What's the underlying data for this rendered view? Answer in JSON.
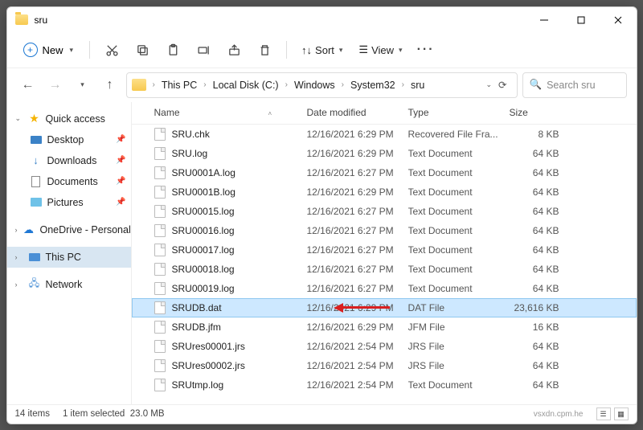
{
  "window": {
    "title": "sru"
  },
  "toolbar": {
    "new_label": "New",
    "sort_label": "Sort",
    "view_label": "View"
  },
  "breadcrumbs": [
    "This PC",
    "Local Disk (C:)",
    "Windows",
    "System32",
    "sru"
  ],
  "search": {
    "placeholder": "Search sru"
  },
  "sidebar": {
    "quick_access": "Quick access",
    "desktop": "Desktop",
    "downloads": "Downloads",
    "documents": "Documents",
    "pictures": "Pictures",
    "onedrive": "OneDrive - Personal",
    "this_pc": "This PC",
    "network": "Network"
  },
  "columns": {
    "name": "Name",
    "date": "Date modified",
    "type": "Type",
    "size": "Size"
  },
  "files": [
    {
      "name": "SRU.chk",
      "date": "12/16/2021 6:29 PM",
      "type": "Recovered File Fra...",
      "size": "8 KB",
      "selected": false
    },
    {
      "name": "SRU.log",
      "date": "12/16/2021 6:29 PM",
      "type": "Text Document",
      "size": "64 KB",
      "selected": false
    },
    {
      "name": "SRU0001A.log",
      "date": "12/16/2021 6:27 PM",
      "type": "Text Document",
      "size": "64 KB",
      "selected": false
    },
    {
      "name": "SRU0001B.log",
      "date": "12/16/2021 6:29 PM",
      "type": "Text Document",
      "size": "64 KB",
      "selected": false
    },
    {
      "name": "SRU00015.log",
      "date": "12/16/2021 6:27 PM",
      "type": "Text Document",
      "size": "64 KB",
      "selected": false
    },
    {
      "name": "SRU00016.log",
      "date": "12/16/2021 6:27 PM",
      "type": "Text Document",
      "size": "64 KB",
      "selected": false
    },
    {
      "name": "SRU00017.log",
      "date": "12/16/2021 6:27 PM",
      "type": "Text Document",
      "size": "64 KB",
      "selected": false
    },
    {
      "name": "SRU00018.log",
      "date": "12/16/2021 6:27 PM",
      "type": "Text Document",
      "size": "64 KB",
      "selected": false
    },
    {
      "name": "SRU00019.log",
      "date": "12/16/2021 6:27 PM",
      "type": "Text Document",
      "size": "64 KB",
      "selected": false
    },
    {
      "name": "SRUDB.dat",
      "date": "12/16/2021 6:29 PM",
      "type": "DAT File",
      "size": "23,616 KB",
      "selected": true
    },
    {
      "name": "SRUDB.jfm",
      "date": "12/16/2021 6:29 PM",
      "type": "JFM File",
      "size": "16 KB",
      "selected": false
    },
    {
      "name": "SRUres00001.jrs",
      "date": "12/16/2021 2:54 PM",
      "type": "JRS File",
      "size": "64 KB",
      "selected": false
    },
    {
      "name": "SRUres00002.jrs",
      "date": "12/16/2021 2:54 PM",
      "type": "JRS File",
      "size": "64 KB",
      "selected": false
    },
    {
      "name": "SRUtmp.log",
      "date": "12/16/2021 2:54 PM",
      "type": "Text Document",
      "size": "64 KB",
      "selected": false
    }
  ],
  "status": {
    "count": "14 items",
    "selection": "1 item selected",
    "size": "23.0 MB"
  },
  "watermark": "vsxdn.cpm.he"
}
